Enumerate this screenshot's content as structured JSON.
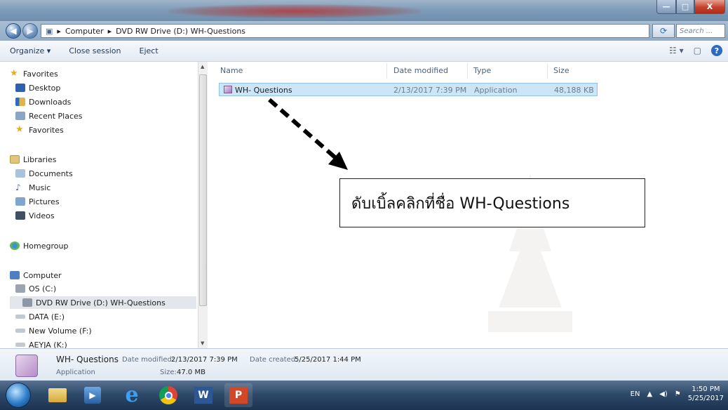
{
  "window": {
    "min_label": "—",
    "max_label": "□",
    "close_label": "X"
  },
  "address": {
    "path": [
      "Computer",
      "DVD RW Drive (D:) WH-Questions"
    ],
    "search_placeholder": "Search ..."
  },
  "toolbar": {
    "organize_label": "Organize ▾",
    "close_session_label": "Close session",
    "eject_label": "Eject"
  },
  "nav": {
    "favorites_header": "Favorites",
    "favorites": [
      "Desktop",
      "Downloads",
      "Recent Places",
      "Favorites"
    ],
    "libraries_header": "Libraries",
    "libraries": [
      "Documents",
      "Music",
      "Pictures",
      "Videos"
    ],
    "homegroup": "Homegroup",
    "computer_header": "Computer",
    "drives": [
      "OS (C:)",
      "DVD RW Drive (D:) WH-Questions",
      "DATA (E:)",
      "New Volume (F:)",
      "AEYJA (K:)"
    ]
  },
  "columns": {
    "name": "Name",
    "date": "Date modified",
    "type": "Type",
    "size": "Size"
  },
  "files": [
    {
      "name": "WH- Questions",
      "date": "2/13/2017 7:39 PM",
      "type": "Application",
      "size": "48,188 KB"
    }
  ],
  "callout_text": "ดับเบิ้ลคลิกที่ชื่อ WH-Questions",
  "details": {
    "name": "WH- Questions",
    "date_modified_label": "Date modified:",
    "date_modified": "2/13/2017 7:39 PM",
    "date_created_label": "Date created:",
    "date_created": "5/25/2017 1:44 PM",
    "type": "Application",
    "size_label": "Size:",
    "size": "47.0 MB"
  },
  "tray": {
    "lang": "EN",
    "time": "1:50 PM",
    "date": "5/25/2017"
  },
  "colors": {
    "selection": "#cde6f7",
    "titlebar": "#7f9cb8",
    "taskbar": "#2f4a6a"
  }
}
